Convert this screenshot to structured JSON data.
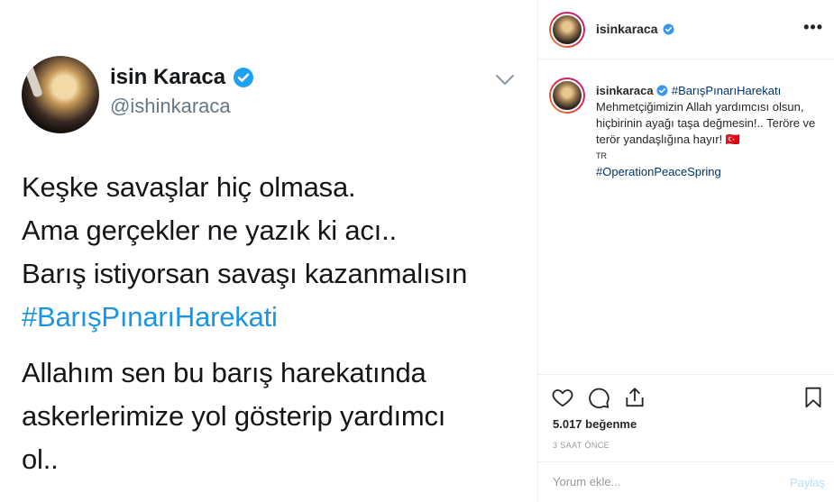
{
  "tweet": {
    "display_name": "isin Karaca",
    "handle": "@ishinkaraca",
    "line1": "Keşke savaşlar hiç olmasa.",
    "line2": "Ama gerçekler ne yazık ki acı..",
    "line3": "Barış istiyorsan savaşı kazanmalısın",
    "hashtag": "#BarışPınarıHarekati",
    "para2_line1": "Allahım sen bu barış harekatında",
    "para2_line2": "askerlerimize yol gösterip yardımcı",
    "para2_line3": "ol.."
  },
  "post": {
    "username": "isinkaraca",
    "more_label": "•••",
    "caption": {
      "username": "isinkaraca",
      "hashtag1": "#BarışPınarıHarekatı",
      "text": "Mehmetçiğimizin Allah yardımcısı olsun, hiçbirinin ayağı taşa değmesin!.. Teröre ve terör yandaşlığına hayır! 🇹🇷",
      "lang_code": "TR",
      "hashtag2": "#OperationPeaceSpring"
    },
    "likes": "5.017 beğenme",
    "time_ago": "3 SAAT ÖNCE",
    "comment_placeholder": "Yorum ekle...",
    "post_button": "Paylaş"
  },
  "colors": {
    "twitter_blue": "#1b95e0",
    "verified_blue": "#3897f0",
    "hashtag_ig": "#003569",
    "post_button_disabled": "#b2dffc"
  },
  "icons": [
    "verified-badge-icon",
    "chevron-down-icon",
    "heart-icon",
    "comment-icon",
    "share-icon",
    "bookmark-icon",
    "more-icon"
  ]
}
